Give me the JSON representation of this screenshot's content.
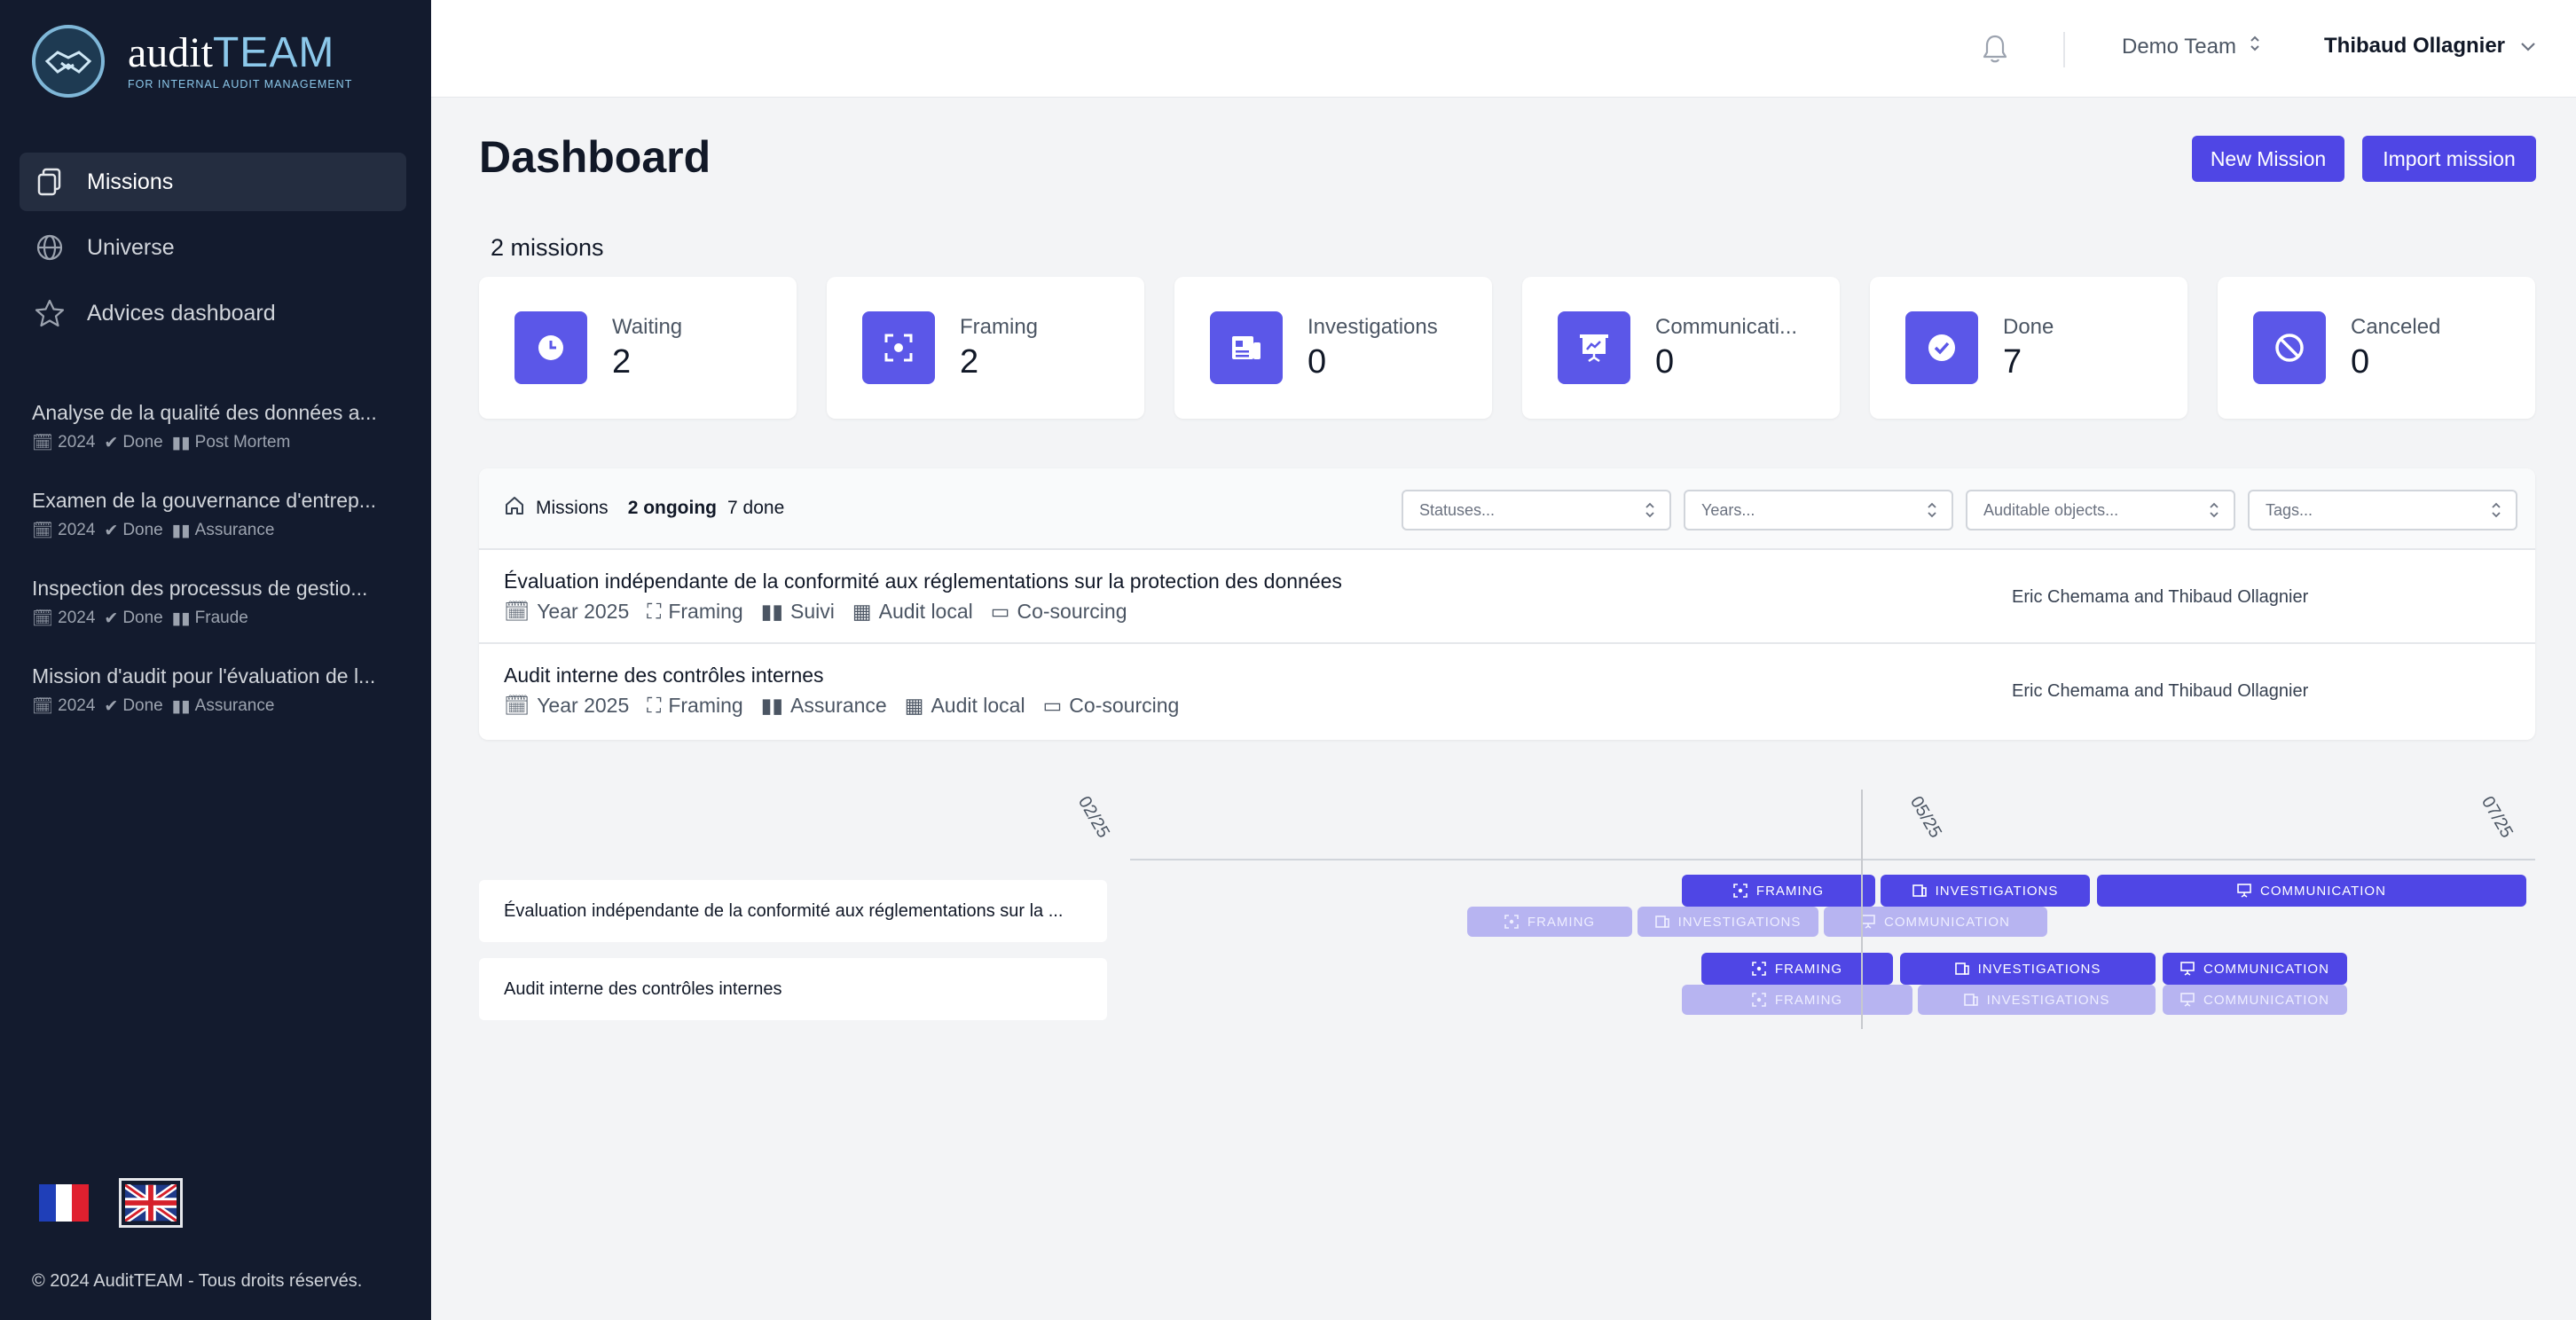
{
  "brand": {
    "main": "audit",
    "accent": "TEAM",
    "tagline": "FOR INTERNAL AUDIT MANAGEMENT"
  },
  "sidebar": {
    "nav": [
      {
        "label": "Missions",
        "icon": "document-icon",
        "active": true
      },
      {
        "label": "Universe",
        "icon": "globe-icon",
        "active": false
      },
      {
        "label": "Advices dashboard",
        "icon": "star-icon",
        "active": false
      }
    ],
    "recent": [
      {
        "title": "Analyse de la qualité des données a...",
        "year": "2024",
        "status": "Done",
        "category": "Post Mortem"
      },
      {
        "title": "Examen de la gouvernance d'entrep...",
        "year": "2024",
        "status": "Done",
        "category": "Assurance"
      },
      {
        "title": "Inspection des processus de gestio...",
        "year": "2024",
        "status": "Done",
        "category": "Fraude"
      },
      {
        "title": "Mission d'audit pour l'évaluation de l...",
        "year": "2024",
        "status": "Done",
        "category": "Assurance"
      }
    ],
    "footer": "© 2024 AuditTEAM - Tous droits réservés."
  },
  "topbar": {
    "team": "Demo Team",
    "user": "Thibaud Ollagnier"
  },
  "page": {
    "title": "Dashboard",
    "new_mission": "New Mission",
    "import_mission": "Import mission",
    "missions_count": "2 missions"
  },
  "cards": [
    {
      "label": "Waiting",
      "value": "2",
      "icon": "clock-icon"
    },
    {
      "label": "Framing",
      "value": "2",
      "icon": "focus-icon"
    },
    {
      "label": "Investigations",
      "value": "0",
      "icon": "newspaper-icon"
    },
    {
      "label": "Communicati...",
      "value": "0",
      "icon": "presentation-icon"
    },
    {
      "label": "Done",
      "value": "7",
      "icon": "check-circle-icon"
    },
    {
      "label": "Canceled",
      "value": "0",
      "icon": "ban-icon"
    }
  ],
  "panel": {
    "crumb": "Missions",
    "ongoing": "2 ongoing",
    "done": "7 done",
    "filters": [
      "Statuses...",
      "Years...",
      "Auditable objects...",
      "Tags..."
    ],
    "missions": [
      {
        "title": "Évaluation indépendante de la conformité aux réglementations sur la protection des données",
        "meta": [
          "Year 2025",
          "Framing",
          "Suivi",
          "Audit local",
          "Co-sourcing"
        ],
        "owners": "Eric Chemama and Thibaud Ollagnier"
      },
      {
        "title": "Audit interne des contrôles internes",
        "meta": [
          "Year 2025",
          "Framing",
          "Assurance",
          "Audit local",
          "Co-sourcing"
        ],
        "owners": "Eric Chemama and Thibaud Ollagnier"
      }
    ]
  },
  "timeline": {
    "dates": [
      "02/25",
      "05/25",
      "07/25"
    ],
    "rows": [
      {
        "label": "Évaluation indépendante de la conformité aux réglementations sur la ..."
      },
      {
        "label": "Audit interne des contrôles internes"
      }
    ],
    "phases": {
      "framing": "FRAMING",
      "investigations": "INVESTIGATIONS",
      "communication": "COMMUNICATION"
    }
  },
  "colors": {
    "accent": "#4f46e5",
    "sidebar": "#131b2e",
    "ghost": "#b7b4f1"
  }
}
